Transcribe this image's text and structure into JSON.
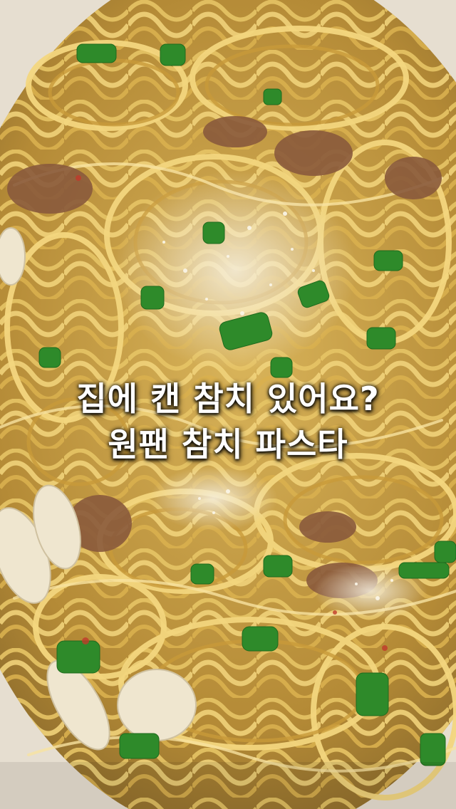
{
  "overlay": {
    "line1": "집에 캔 참치 있어요?",
    "line2": "원팬 참치 파스타"
  },
  "photo": {
    "subject": "spaghetti-with-tuna-parmesan-scallions",
    "colors": {
      "noodle": "#e8c866",
      "noodle_shade": "#b8902e",
      "scallion": "#2e8a2a",
      "cheese": "#f4efe0",
      "tuna": "#8a5a3c",
      "pan": "#e9e2d6"
    }
  }
}
